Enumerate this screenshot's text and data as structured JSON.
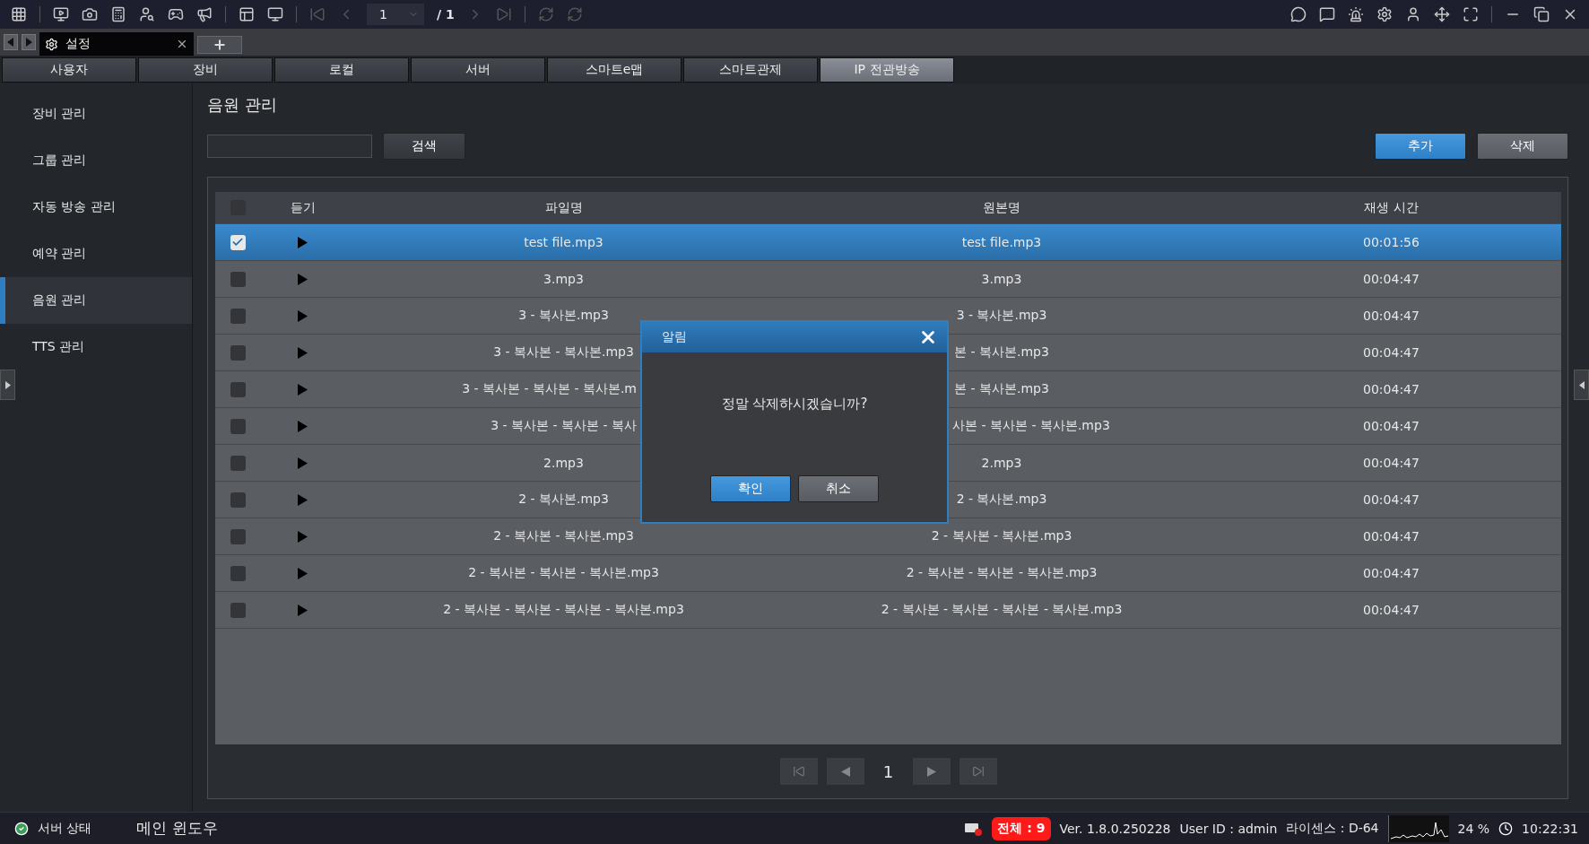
{
  "toolbar": {
    "page": "1",
    "page_total": "/ 1"
  },
  "doc_tab": {
    "label": "설정"
  },
  "nav_tabs": [
    {
      "label": "사용자",
      "selected": false
    },
    {
      "label": "장비",
      "selected": false
    },
    {
      "label": "로컬",
      "selected": false
    },
    {
      "label": "서버",
      "selected": false
    },
    {
      "label": "스마트e맵",
      "selected": false
    },
    {
      "label": "스마트관제",
      "selected": false
    },
    {
      "label": "IP 전관방송",
      "selected": true
    }
  ],
  "sidebar": {
    "items": [
      {
        "label": "장비 관리",
        "selected": false
      },
      {
        "label": "그룹 관리",
        "selected": false
      },
      {
        "label": "자동 방송 관리",
        "selected": false
      },
      {
        "label": "예약 관리",
        "selected": false
      },
      {
        "label": "음원 관리",
        "selected": true
      },
      {
        "label": "TTS 관리",
        "selected": false
      }
    ]
  },
  "page_title": "음원 관리",
  "search": {
    "button": "검색"
  },
  "actions": [
    {
      "label": "추가",
      "kind": "primary"
    },
    {
      "label": "삭제",
      "kind": "secondary"
    }
  ],
  "table": {
    "header_checked": false,
    "columns": [
      "듣기",
      "파일명",
      "원본명",
      "재생 시간"
    ],
    "rows": [
      {
        "checked": true,
        "selected": true,
        "file": {
          "text": "test file.mp3"
        },
        "original": {
          "text": "test file.mp3"
        },
        "duration": "00:01:56"
      },
      {
        "checked": false,
        "selected": false,
        "file": {
          "text": "3.mp3"
        },
        "original": {
          "text": "3.mp3"
        },
        "duration": "00:04:47"
      },
      {
        "checked": false,
        "selected": false,
        "file": {
          "text": "3 - 복사본.mp3"
        },
        "original": {
          "text": "3 - 복사본.mp3"
        },
        "duration": "00:04:47"
      },
      {
        "checked": false,
        "selected": false,
        "file": {
          "text": "3 - 복사본 - 복사본.mp3"
        },
        "original": {
          "text": "본 - 복사본.mp3"
        },
        "duration": "00:04:47"
      },
      {
        "checked": false,
        "selected": false,
        "file": {
          "text": "3 - 복사본 - 복사본 - 복사본.m",
          "covered": true
        },
        "original": {
          "text": "본 - 복사본.mp3"
        },
        "duration": "00:04:47"
      },
      {
        "checked": false,
        "selected": false,
        "file": {
          "text": "3 - 복사본 - 복사본 - 복사",
          "covered": true
        },
        "original": {
          "text": "사본 - 복사본 - 복사본.mp3",
          "covered": true
        },
        "duration": "00:04:47"
      },
      {
        "checked": false,
        "selected": false,
        "file": {
          "text": "2.mp3"
        },
        "original": {
          "text": "2.mp3"
        },
        "duration": "00:04:47"
      },
      {
        "checked": false,
        "selected": false,
        "file": {
          "text": "2 - 복사본.mp3"
        },
        "original": {
          "text": "2 - 복사본.mp3"
        },
        "duration": "00:04:47"
      },
      {
        "checked": false,
        "selected": false,
        "file": {
          "text": "2 - 복사본 - 복사본.mp3"
        },
        "original": {
          "text": "2 - 복사본 - 복사본.mp3"
        },
        "duration": "00:04:47"
      },
      {
        "checked": false,
        "selected": false,
        "file": {
          "text": "2 - 복사본 - 복사본 - 복사본.mp3"
        },
        "original": {
          "text": "2 - 복사본 - 복사본 - 복사본.mp3"
        },
        "duration": "00:04:47"
      },
      {
        "checked": false,
        "selected": false,
        "file": {
          "text": "2 - 복사본 - 복사본 - 복사본 - 복사본.mp3"
        },
        "original": {
          "text": "2 - 복사본 - 복사본 - 복사본 - 복사본.mp3"
        },
        "duration": "00:04:47"
      }
    ]
  },
  "pagination": {
    "page": "1"
  },
  "dialog": {
    "title": "알림",
    "message": "정말 삭제하시겠습니까?",
    "buttons": [
      {
        "label": "확인",
        "kind": "primary"
      },
      {
        "label": "취소",
        "kind": "secondary"
      }
    ]
  },
  "status_bar": {
    "server": "서버 상태",
    "window": "메인 윈도우",
    "total": "전체 : 9",
    "version": "Ver. 1.8.0.250228",
    "user": "User ID : admin",
    "license": "라이센스 : D-64",
    "cpu": "24 %",
    "time": "10:22:31"
  }
}
